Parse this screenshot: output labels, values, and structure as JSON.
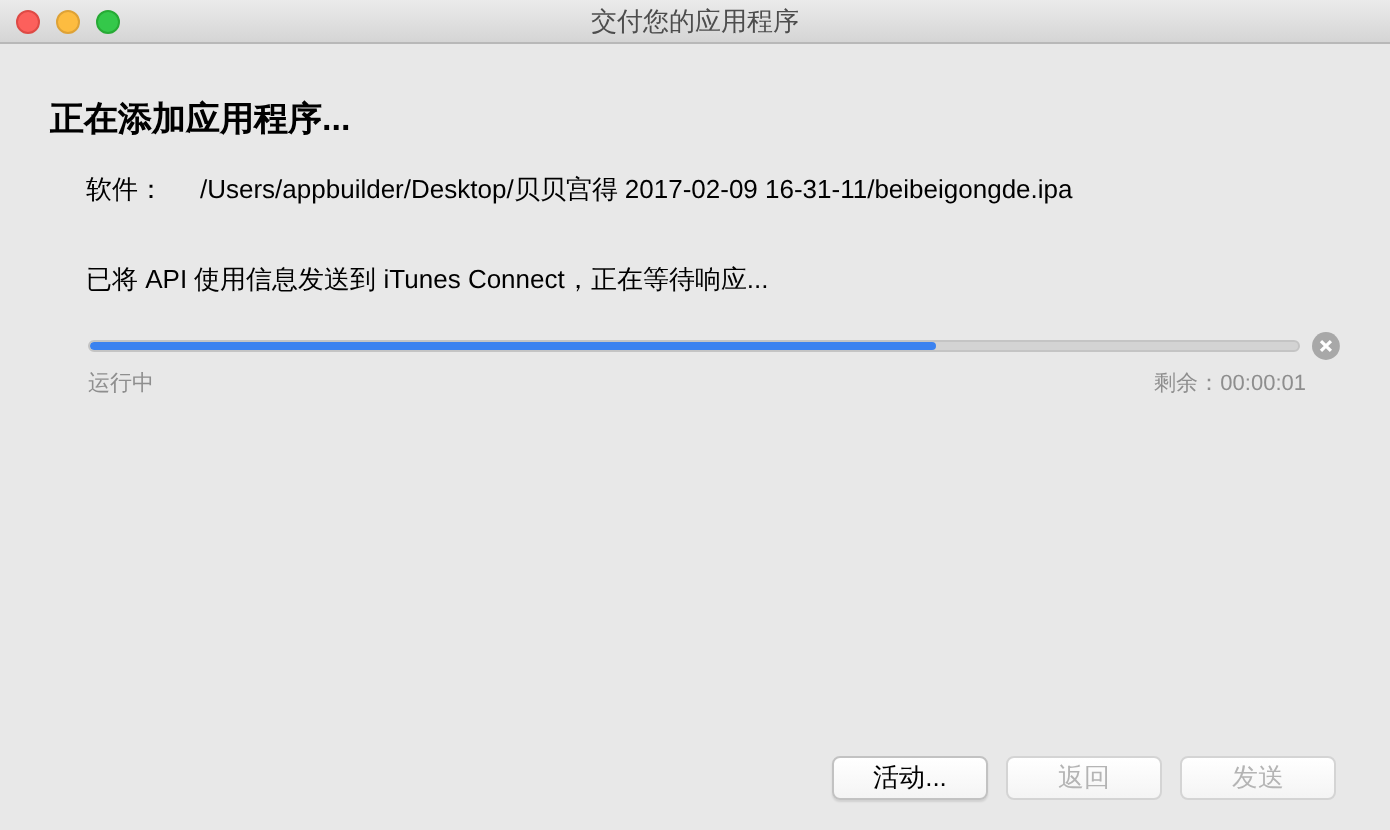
{
  "window": {
    "title": "交付您的应用程序"
  },
  "heading": "正在添加应用程序...",
  "software": {
    "label": "软件：",
    "path": "/Users/appbuilder/Desktop/贝贝宫得 2017-02-09 16-31-11/beibeigongde.ipa"
  },
  "status": "已将 API 使用信息发送到 iTunes Connect，正在等待响应...",
  "progress": {
    "level": 0.7,
    "state": "运行中",
    "remaining": "剩余：00:00:01"
  },
  "buttons": [
    {
      "label": "活动...",
      "disabled": false
    },
    {
      "label": "返回",
      "disabled": true
    },
    {
      "label": "发送",
      "disabled": true
    }
  ]
}
